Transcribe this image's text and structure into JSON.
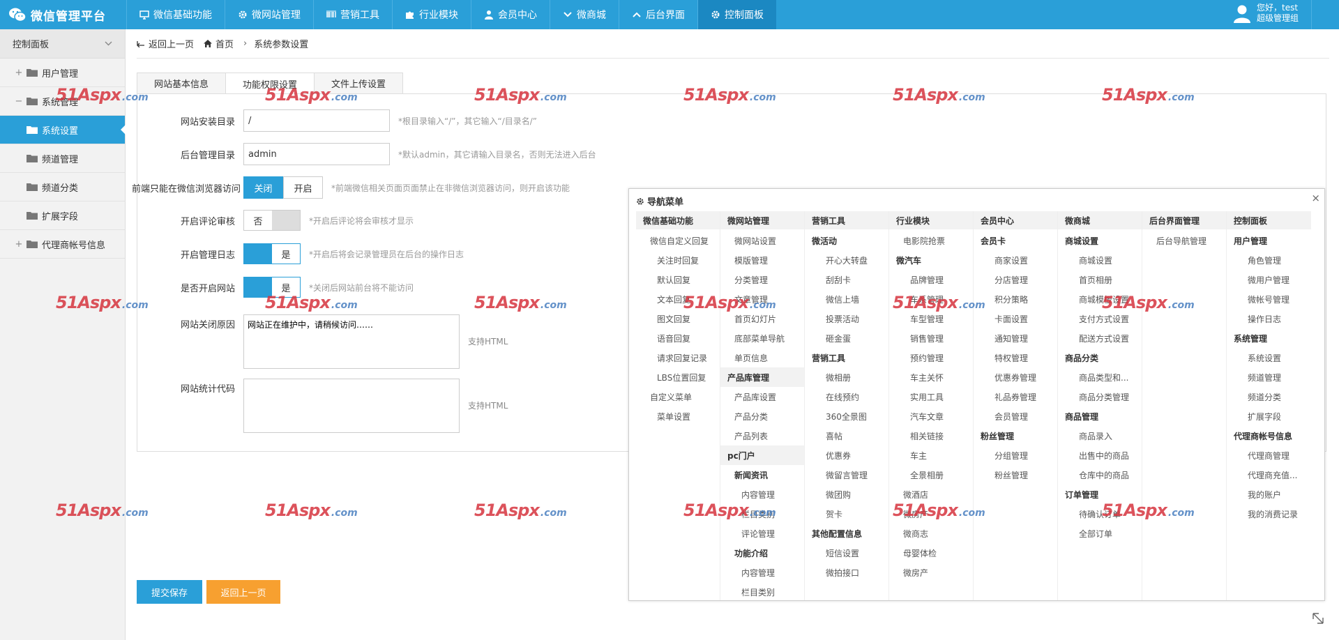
{
  "brand": {
    "title": "微信管理平台"
  },
  "topnav": [
    {
      "label": "微信基础功能",
      "icon": "monitor-icon"
    },
    {
      "label": "微网站管理",
      "icon": "gear-icon"
    },
    {
      "label": "营销工具",
      "icon": "barcode-icon"
    },
    {
      "label": "行业模块",
      "icon": "puzzle-icon"
    },
    {
      "label": "会员中心",
      "icon": "user-icon"
    },
    {
      "label": "微商城",
      "icon": "chevron-down-icon"
    },
    {
      "label": "后台界面",
      "icon": "chevron-up-icon"
    },
    {
      "label": "控制面板",
      "icon": "gear-icon"
    }
  ],
  "user": {
    "greeting": "您好，test",
    "role": "超级管理组"
  },
  "sidebar": {
    "header": "控制面板",
    "items": [
      {
        "label": "用户管理",
        "toggle": "+"
      },
      {
        "label": "系统管理",
        "toggle": "−"
      },
      {
        "label": "系统设置"
      },
      {
        "label": "频道管理"
      },
      {
        "label": "频道分类"
      },
      {
        "label": "扩展字段"
      },
      {
        "label": "代理商帐号信息",
        "toggle": "+"
      }
    ]
  },
  "breadcrumb": {
    "back": "返回上一页",
    "home": "首页",
    "current": "系统参数设置"
  },
  "tabs": [
    "网站基本信息",
    "功能权限设置",
    "文件上传设置"
  ],
  "form": {
    "install_dir": {
      "label": "网站安装目录",
      "value": "/",
      "hint": "*根目录输入“/”，其它输入“/目录名/”"
    },
    "admin_dir": {
      "label": "后台管理目录",
      "value": "admin",
      "hint": "*默认admin，其它请输入目录名，否则无法进入后台"
    },
    "wechat_only": {
      "label": "前端只能在微信浏览器访问",
      "off": "关闭",
      "on": "开启",
      "hint": "*前端微信相关页面页面禁止在非微信浏览器访问，则开启该功能"
    },
    "comment_review": {
      "label": "开启评论审核",
      "value": "否",
      "hint": "*开启后评论将会审核才显示"
    },
    "admin_log": {
      "label": "开启管理日志",
      "value": "是",
      "hint": "*开启后将会记录管理员在后台的操作日志"
    },
    "site_open": {
      "label": "是否开启网站",
      "value": "是",
      "hint": "*关闭后网站前台将不能访问"
    },
    "close_reason": {
      "label": "网站关闭原因",
      "value": "网站正在维护中，请稍候访问……",
      "side": "支持HTML"
    },
    "stat_code": {
      "label": "网站统计代码",
      "value": "",
      "side": "支持HTML"
    }
  },
  "buttons": {
    "submit": "提交保存",
    "back": "返回上一页"
  },
  "popup": {
    "title": "导航菜单",
    "columns": [
      {
        "head": "微信基础功能",
        "items": [
          {
            "t": "微信自定义回复",
            "lv": 1
          },
          {
            "t": "关注时回复",
            "lv": 2
          },
          {
            "t": "默认回复",
            "lv": 2
          },
          {
            "t": "文本回复",
            "lv": 2
          },
          {
            "t": "图文回复",
            "lv": 2
          },
          {
            "t": "语音回复",
            "lv": 2
          },
          {
            "t": "请求回复记录",
            "lv": 2
          },
          {
            "t": "LBS位置回复",
            "lv": 2
          },
          {
            "t": "自定义菜单",
            "lv": 1
          },
          {
            "t": "菜单设置",
            "lv": 2
          }
        ]
      },
      {
        "head": "微网站管理",
        "items": [
          {
            "t": "微网站设置",
            "lv": 1
          },
          {
            "t": "模版管理",
            "lv": 1
          },
          {
            "t": "分类管理",
            "lv": 1
          },
          {
            "t": "文章管理",
            "lv": 1
          },
          {
            "t": "首页幻灯片",
            "lv": 1
          },
          {
            "t": "底部菜单导航",
            "lv": 1
          },
          {
            "t": "单页信息",
            "lv": 1
          },
          {
            "t": "产品库管理",
            "lv": 0
          },
          {
            "t": "产品库设置",
            "lv": 1
          },
          {
            "t": "产品分类",
            "lv": 1
          },
          {
            "t": "产品列表",
            "lv": 1
          },
          {
            "t": "pc门户",
            "lv": 0
          },
          {
            "t": "新闻资讯",
            "lv": 1,
            "bold": true
          },
          {
            "t": "内容管理",
            "lv": 2
          },
          {
            "t": "栏目类别",
            "lv": 2
          },
          {
            "t": "评论管理",
            "lv": 2
          },
          {
            "t": "功能介绍",
            "lv": 1,
            "bold": true
          },
          {
            "t": "内容管理",
            "lv": 2
          },
          {
            "t": "栏目类别",
            "lv": 2
          }
        ]
      },
      {
        "head": "营销工具",
        "items": [
          {
            "t": "微活动",
            "lv": 1,
            "bold": true
          },
          {
            "t": "开心大转盘",
            "lv": 2
          },
          {
            "t": "刮刮卡",
            "lv": 2
          },
          {
            "t": "微信上墙",
            "lv": 2
          },
          {
            "t": "投票活动",
            "lv": 2
          },
          {
            "t": "砸金蛋",
            "lv": 2
          },
          {
            "t": "营销工具",
            "lv": 1,
            "bold": true
          },
          {
            "t": "微相册",
            "lv": 2
          },
          {
            "t": "在线预约",
            "lv": 2
          },
          {
            "t": "360全景图",
            "lv": 2
          },
          {
            "t": "喜帖",
            "lv": 2
          },
          {
            "t": "优惠券",
            "lv": 2
          },
          {
            "t": "微留言管理",
            "lv": 2
          },
          {
            "t": "微团购",
            "lv": 2
          },
          {
            "t": "贺卡",
            "lv": 2
          },
          {
            "t": "其他配置信息",
            "lv": 1,
            "bold": true
          },
          {
            "t": "短信设置",
            "lv": 2
          },
          {
            "t": "微拍接口",
            "lv": 2
          }
        ]
      },
      {
        "head": "行业模块",
        "items": [
          {
            "t": "电影院抢票",
            "lv": 1
          },
          {
            "t": "微汽车",
            "lv": 1,
            "bold": true
          },
          {
            "t": "品牌管理",
            "lv": 2
          },
          {
            "t": "车系管理",
            "lv": 2
          },
          {
            "t": "车型管理",
            "lv": 2
          },
          {
            "t": "销售管理",
            "lv": 2
          },
          {
            "t": "预约管理",
            "lv": 2
          },
          {
            "t": "车主关怀",
            "lv": 2
          },
          {
            "t": "实用工具",
            "lv": 2
          },
          {
            "t": "汽车文章",
            "lv": 2
          },
          {
            "t": "相关链接",
            "lv": 2
          },
          {
            "t": "车主",
            "lv": 2
          },
          {
            "t": "全景相册",
            "lv": 2
          },
          {
            "t": "微酒店",
            "lv": 1
          },
          {
            "t": "微房产",
            "lv": 1
          },
          {
            "t": "微商志",
            "lv": 1
          },
          {
            "t": "母婴体检",
            "lv": 1
          },
          {
            "t": "微房产",
            "lv": 1
          }
        ]
      },
      {
        "head": "会员中心",
        "items": [
          {
            "t": "会员卡",
            "lv": 1,
            "bold": true
          },
          {
            "t": "商家设置",
            "lv": 2
          },
          {
            "t": "分店管理",
            "lv": 2
          },
          {
            "t": "积分策略",
            "lv": 2
          },
          {
            "t": "卡面设置",
            "lv": 2
          },
          {
            "t": "通知管理",
            "lv": 2
          },
          {
            "t": "特权管理",
            "lv": 2
          },
          {
            "t": "优惠券管理",
            "lv": 2
          },
          {
            "t": "礼品券管理",
            "lv": 2
          },
          {
            "t": "会员管理",
            "lv": 2
          },
          {
            "t": "粉丝管理",
            "lv": 1,
            "bold": true
          },
          {
            "t": "分组管理",
            "lv": 2
          },
          {
            "t": "粉丝管理",
            "lv": 2
          }
        ]
      },
      {
        "head": "微商城",
        "items": [
          {
            "t": "商城设置",
            "lv": 1,
            "bold": true
          },
          {
            "t": "商城设置",
            "lv": 2
          },
          {
            "t": "首页相册",
            "lv": 2
          },
          {
            "t": "商城模板设置",
            "lv": 2
          },
          {
            "t": "支付方式设置",
            "lv": 2
          },
          {
            "t": "配送方式设置",
            "lv": 2
          },
          {
            "t": "商品分类",
            "lv": 1,
            "bold": true
          },
          {
            "t": "商品类型和...",
            "lv": 2
          },
          {
            "t": "商品分类管理",
            "lv": 2
          },
          {
            "t": "商品管理",
            "lv": 1,
            "bold": true
          },
          {
            "t": "商品录入",
            "lv": 2
          },
          {
            "t": "出售中的商品",
            "lv": 2
          },
          {
            "t": "仓库中的商品",
            "lv": 2
          },
          {
            "t": "订单管理",
            "lv": 1,
            "bold": true
          },
          {
            "t": "待确认订单",
            "lv": 2
          },
          {
            "t": "全部订单",
            "lv": 2
          }
        ]
      },
      {
        "head": "后台界面管理",
        "items": [
          {
            "t": "后台导航管理",
            "lv": 1
          }
        ]
      },
      {
        "head": "控制面板",
        "items": [
          {
            "t": "用户管理",
            "lv": 1,
            "bold": true
          },
          {
            "t": "角色管理",
            "lv": 2
          },
          {
            "t": "微用户管理",
            "lv": 2
          },
          {
            "t": "微帐号管理",
            "lv": 2
          },
          {
            "t": "操作日志",
            "lv": 2
          },
          {
            "t": "系统管理",
            "lv": 1,
            "bold": true
          },
          {
            "t": "系统设置",
            "lv": 2
          },
          {
            "t": "频道管理",
            "lv": 2
          },
          {
            "t": "频道分类",
            "lv": 2
          },
          {
            "t": "扩展字段",
            "lv": 2
          },
          {
            "t": "代理商帐号信息",
            "lv": 1,
            "bold": true
          },
          {
            "t": "代理商管理",
            "lv": 2
          },
          {
            "t": "代理商充值...",
            "lv": 2
          },
          {
            "t": "我的账户",
            "lv": 2
          },
          {
            "t": "我的消费记录",
            "lv": 2
          }
        ]
      }
    ]
  },
  "watermark": {
    "big": "51Aspx",
    "small": ".com"
  },
  "colors": {
    "primary": "#2a9fd8",
    "active_nav": "#1b88c2",
    "orange": "#f7a030",
    "watermark_red": "#d6353f",
    "watermark_blue": "#4a7fc0"
  }
}
